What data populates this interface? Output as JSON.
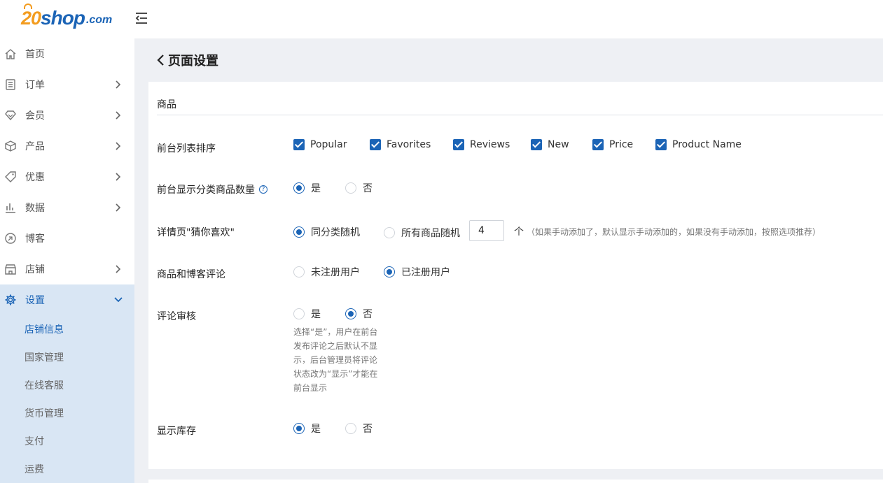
{
  "brand": {
    "num": "20",
    "shop": "shop",
    "com": ".com"
  },
  "sidebar": {
    "items": [
      {
        "label": "首页"
      },
      {
        "label": "订单"
      },
      {
        "label": "会员"
      },
      {
        "label": "产品"
      },
      {
        "label": "优惠"
      },
      {
        "label": "数据"
      },
      {
        "label": "博客"
      },
      {
        "label": "店铺"
      },
      {
        "label": "设置"
      }
    ],
    "submenu": [
      "店铺信息",
      "国家管理",
      "在线客服",
      "货币管理",
      "支付",
      "运费"
    ]
  },
  "page": {
    "title": "页面设置"
  },
  "section": {
    "title": "商品"
  },
  "form": {
    "sort": {
      "label": "前台列表排序",
      "options": [
        "Popular",
        "Favorites",
        "Reviews",
        "New",
        "Price",
        "Product Name"
      ]
    },
    "category_count": {
      "label": "前台显示分类商品数量",
      "help": "?",
      "yes": "是",
      "no": "否"
    },
    "guess": {
      "label": "详情页\"猜你喜欢\"",
      "opt1": "同分类随机",
      "opt2": "所有商品随机",
      "value": "4",
      "unit": "个",
      "note": "（如果手动添加了，默认显示手动添加的，如果没有手动添加，按照选项推荐）"
    },
    "comment": {
      "label": "商品和博客评论",
      "opt1": "未注册用户",
      "opt2": "已注册用户"
    },
    "review": {
      "label": "评论审核",
      "yes": "是",
      "no": "否",
      "hint": "选择“是”，用户在前台发布评论之后默认不显示，后台管理员将评论状态改为“显示”才能在前台显示"
    },
    "stock": {
      "label": "显示库存",
      "yes": "是",
      "no": "否"
    }
  },
  "colors": {
    "accent": "#1b64b6",
    "brand_orange": "#f39c1f",
    "active_bg": "#d9e6f4"
  }
}
